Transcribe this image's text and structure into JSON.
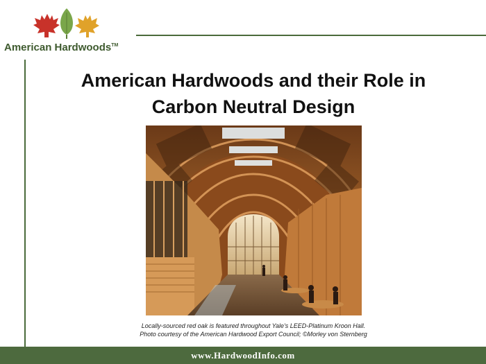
{
  "logo": {
    "brand": "American Hardwoods",
    "trademark": "TM",
    "leaf_colors": [
      "#c8322a",
      "#7aa64a",
      "#e0a22a"
    ]
  },
  "title": {
    "line1": "American Hardwoods and their Role in",
    "line2": "Carbon Neutral Design"
  },
  "photo": {
    "icon": "interior-hall-photo"
  },
  "caption": {
    "line1": "Locally-sourced red oak is featured throughout Yale's LEED-Platinum Kroon Hall.",
    "line2": "Photo courtesy of the American Hardwood Export Council; ©Morley von Sternberg"
  },
  "footer": {
    "url": "www.HardwoodInfo.com"
  },
  "colors": {
    "accent_green": "#4d6a3e",
    "title_text": "#111111"
  }
}
